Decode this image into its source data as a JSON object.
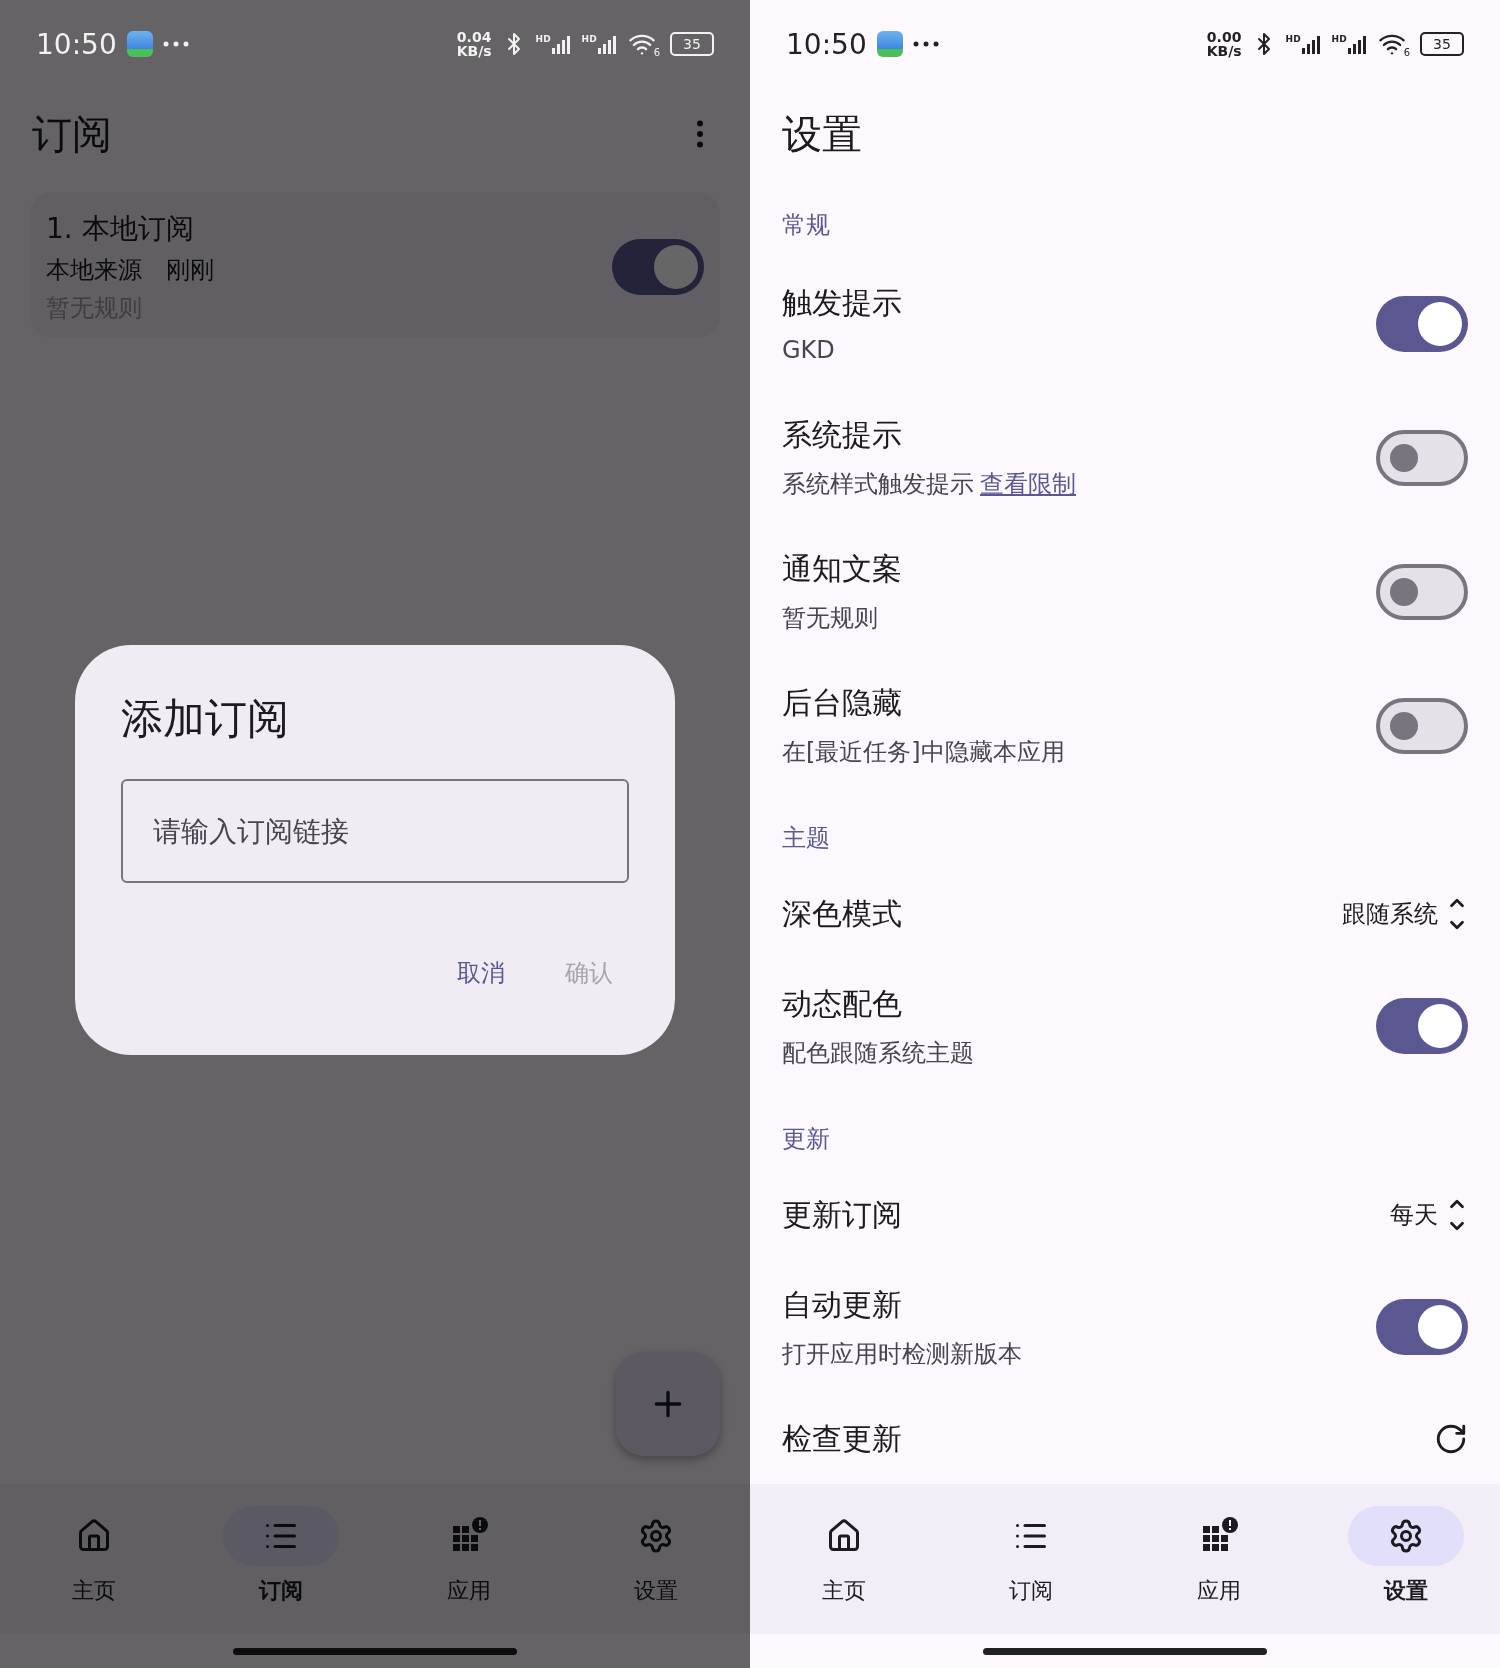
{
  "subscription_screen": {
    "status_bar": {
      "time": "10:50",
      "net_speed": "0.04",
      "net_unit": "KB/s",
      "signal_labels": [
        "HD",
        "HD"
      ],
      "wifi_label": "6",
      "battery": "35"
    },
    "title": "订阅",
    "subscriptions": [
      {
        "title": "1. 本地订阅",
        "source": "本地来源",
        "time": "刚刚",
        "rules": "暂无规则",
        "on": true
      }
    ],
    "dialog": {
      "title": "添加订阅",
      "placeholder": "请输入订阅链接",
      "buttons": [
        {
          "label": "取消",
          "disabled": false
        },
        {
          "label": "确认",
          "disabled": true
        }
      ]
    },
    "nav": [
      {
        "label": "主页",
        "kind": "home",
        "selected": false
      },
      {
        "label": "订阅",
        "kind": "list",
        "selected": true
      },
      {
        "label": "应用",
        "kind": "apps",
        "selected": false
      },
      {
        "label": "设置",
        "kind": "settings",
        "selected": false
      }
    ]
  },
  "settings_screen": {
    "status_bar": {
      "time": "10:50",
      "net_speed": "0.00",
      "net_unit": "KB/s",
      "signal_labels": [
        "HD",
        "HD"
      ],
      "wifi_label": "6",
      "battery": "35"
    },
    "title": "设置",
    "sections": [
      {
        "title": "常规",
        "items": [
          {
            "kind": "switch",
            "title": "触发提示",
            "subtitle": "GKD",
            "on": true
          },
          {
            "kind": "switch",
            "title": "系统提示",
            "subtitle": "系统样式触发提示",
            "link": "查看限制",
            "on": false
          },
          {
            "kind": "switch",
            "title": "通知文案",
            "subtitle": "暂无规则",
            "on": false
          },
          {
            "kind": "switch",
            "title": "后台隐藏",
            "subtitle": "在[最近任务]中隐藏本应用",
            "on": false
          }
        ]
      },
      {
        "title": "主题",
        "items": [
          {
            "kind": "select",
            "title": "深色模式",
            "value": "跟随系统"
          },
          {
            "kind": "switch",
            "title": "动态配色",
            "subtitle": "配色跟随系统主题",
            "on": true
          }
        ]
      },
      {
        "title": "更新",
        "items": [
          {
            "kind": "select",
            "title": "更新订阅",
            "value": "每天"
          },
          {
            "kind": "switch",
            "title": "自动更新",
            "subtitle": "打开应用时检测新版本",
            "on": true
          },
          {
            "kind": "action",
            "title": "检查更新"
          }
        ]
      }
    ],
    "nav": [
      {
        "label": "主页",
        "kind": "home",
        "selected": false
      },
      {
        "label": "订阅",
        "kind": "list",
        "selected": false
      },
      {
        "label": "应用",
        "kind": "apps",
        "selected": false
      },
      {
        "label": "设置",
        "kind": "settings",
        "selected": true
      }
    ]
  }
}
